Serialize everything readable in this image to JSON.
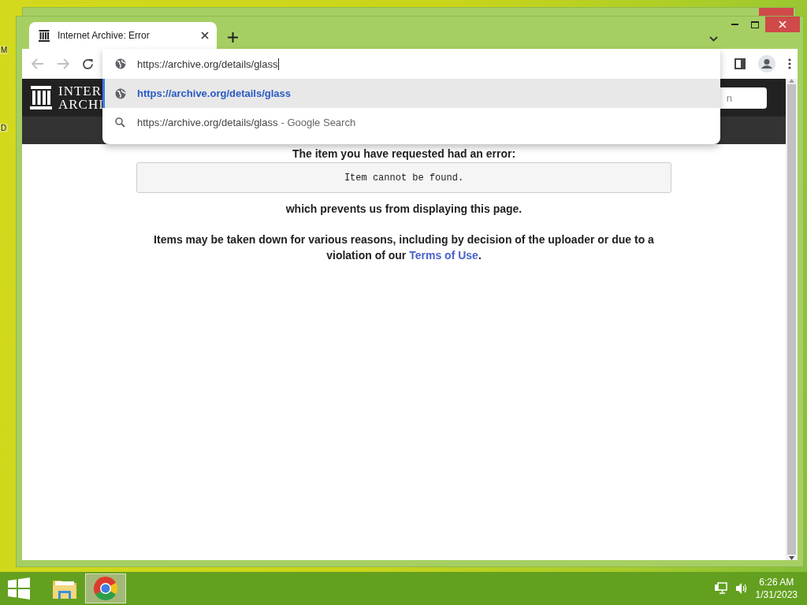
{
  "desktop": {
    "icon_labels": [
      "M",
      "D"
    ]
  },
  "browser": {
    "tabs": [
      {
        "title": "Internet Archive: Error",
        "selected": true
      }
    ],
    "omnibox": {
      "value": "https://archive.org/details/glass"
    },
    "suggestions": [
      {
        "kind": "url",
        "text": "https://archive.org/details/glass",
        "selected": true
      },
      {
        "kind": "search",
        "text": "https://archive.org/details/glass",
        "suffix": "- Google Search",
        "selected": false
      }
    ]
  },
  "site_header": {
    "logo_lines": [
      "INTER",
      "ARCHI"
    ],
    "search_placeholder": "n"
  },
  "error": {
    "heading": "The item you have requested had an error:",
    "message": "Item cannot be found.",
    "consequence": "which prevents us from displaying this page.",
    "explanation": "Items may be taken down for various reasons, including by decision of the uploader or due to a violation of our",
    "link": "Terms of Use",
    "trailing": "."
  },
  "taskbar": {
    "apps": [
      {
        "kind": "folder",
        "active": false
      },
      {
        "kind": "chrome",
        "active": true
      }
    ],
    "time": "6:26 AM",
    "date": "1/31/2023"
  }
}
